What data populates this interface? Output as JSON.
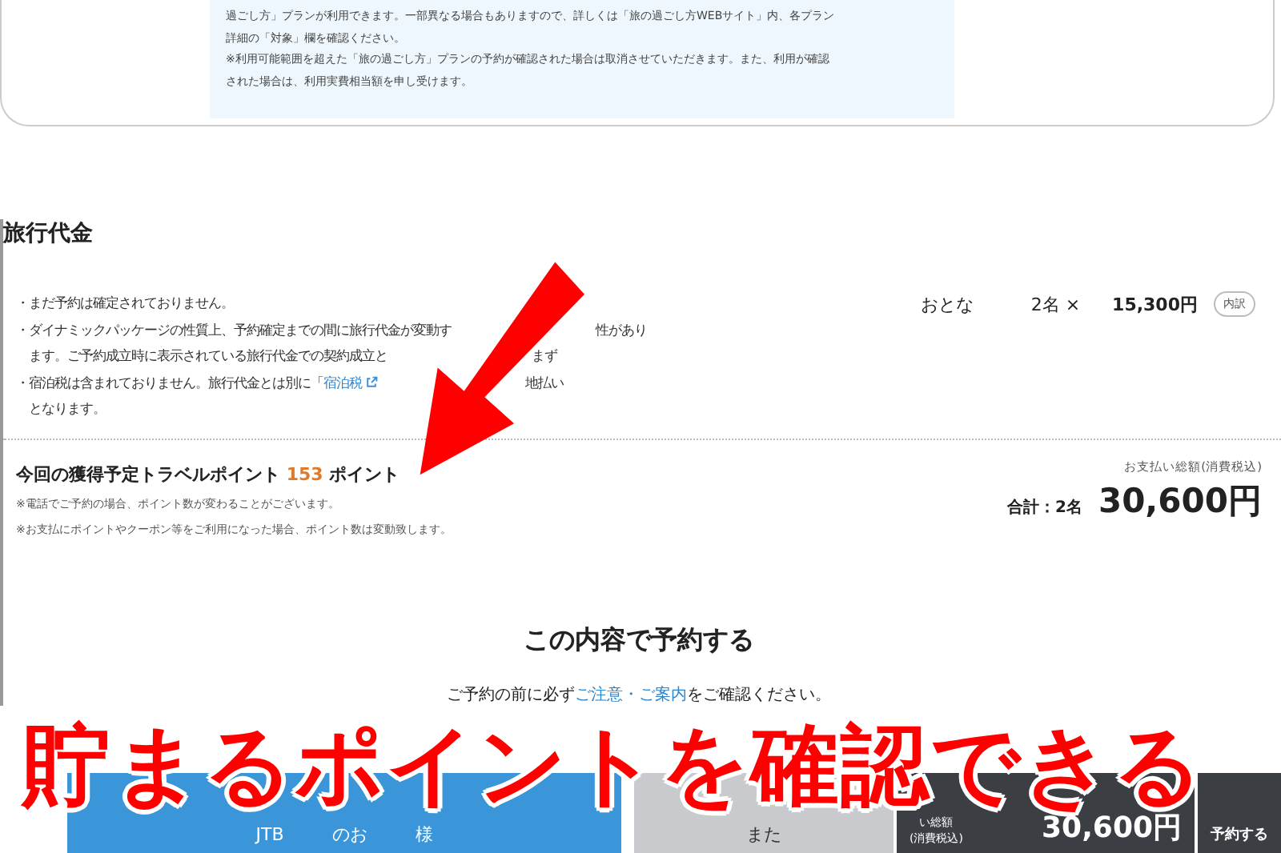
{
  "notice": {
    "lines": [
      "過ごし方」プランが利用できます。一部異なる場合もありますので、詳しくは「旅の過ごし方WEBサイト」内、各プラン",
      "詳細の「対象」欄を確認ください。",
      "※利用可能範囲を超えた「旅の過ごし方」プランの予約が確認された場合は取消させていただきます。また、利用が確認",
      "された場合は、利用実費相当額を申し受けます。"
    ]
  },
  "price_section": {
    "heading": "旅行代金",
    "bullets": [
      {
        "lines": [
          [
            {
              "kind": "text",
              "text": "・まだ予約は確定されておりません。"
            }
          ]
        ]
      },
      {
        "lines": [
          [
            {
              "kind": "text",
              "text": "・ダイナミックパッケージの性質上、予約確定までの間に旅行代金が変動す"
            },
            {
              "kind": "gap"
            },
            {
              "kind": "text",
              "text": "性があり"
            }
          ],
          [
            {
              "kind": "text",
              "text": "ます。ご予約成立時に表示されている旅行代金での契約成立と"
            },
            {
              "kind": "gap"
            },
            {
              "kind": "text",
              "text": "まず"
            }
          ]
        ]
      },
      {
        "lines": [
          [
            {
              "kind": "text",
              "text": "・宿泊税は含まれておりません。旅行代金とは別に「"
            },
            {
              "kind": "link",
              "text": "宿泊税"
            },
            {
              "kind": "gap"
            },
            {
              "kind": "text",
              "text": "地払い"
            }
          ],
          [
            {
              "kind": "text",
              "text": "となります。"
            }
          ]
        ]
      }
    ],
    "fare": {
      "type": "おとな",
      "count": "2名 ×",
      "price": "15,300円",
      "detail_button": "内訳"
    },
    "points": {
      "prefix": "今回の獲得予定トラベルポイント",
      "value": "153",
      "suffix": "ポイント",
      "notes": [
        "※電話でご予約の場合、ポイント数が変わることがございます。",
        "※お支払にポイントやクーポン等をご利用になった場合、ポイント数は変動致します。"
      ]
    },
    "total": {
      "caption": "お支払い総額(消費税込)",
      "label": "合計：2名",
      "amount": "30,600円"
    }
  },
  "confirm": {
    "heading": "この内容で予約する",
    "note_before": "ご予約の前に必ず",
    "note_link": "ご注意・ご案内",
    "note_after": "をご確認ください。"
  },
  "bottom_bar": {
    "member_button": [
      "JTB",
      "のお",
      "様"
    ],
    "other_button": [
      "また"
    ],
    "total_caption": "い総額",
    "total_tax": "(消費税込)",
    "total_amount": "30,600円",
    "reserve_button": "予約する"
  },
  "annotation": {
    "caption": "貯まるポイントを確認できる"
  }
}
